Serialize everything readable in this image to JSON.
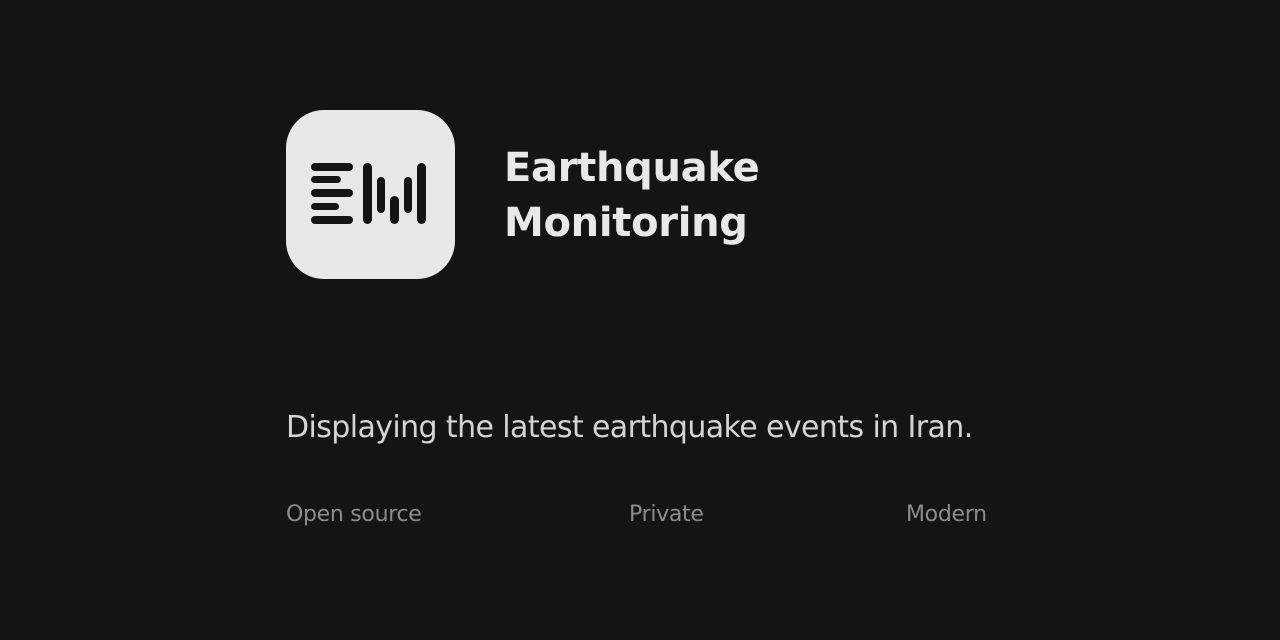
{
  "app": {
    "title_line1": "Earthquake",
    "title_line2": "Monitoring",
    "logo_icon": "seismograph-em-logo-icon"
  },
  "description": "Displaying the latest earthquake events in Iran.",
  "features": [
    "Open source",
    "Private",
    "Modern"
  ],
  "colors": {
    "background": "#141414",
    "logo_tile": "#e8e8e8",
    "logo_glyph": "#141414",
    "title": "#e8e8e8",
    "description": "#d4d4d4",
    "feature_text": "#8c8c8c"
  }
}
